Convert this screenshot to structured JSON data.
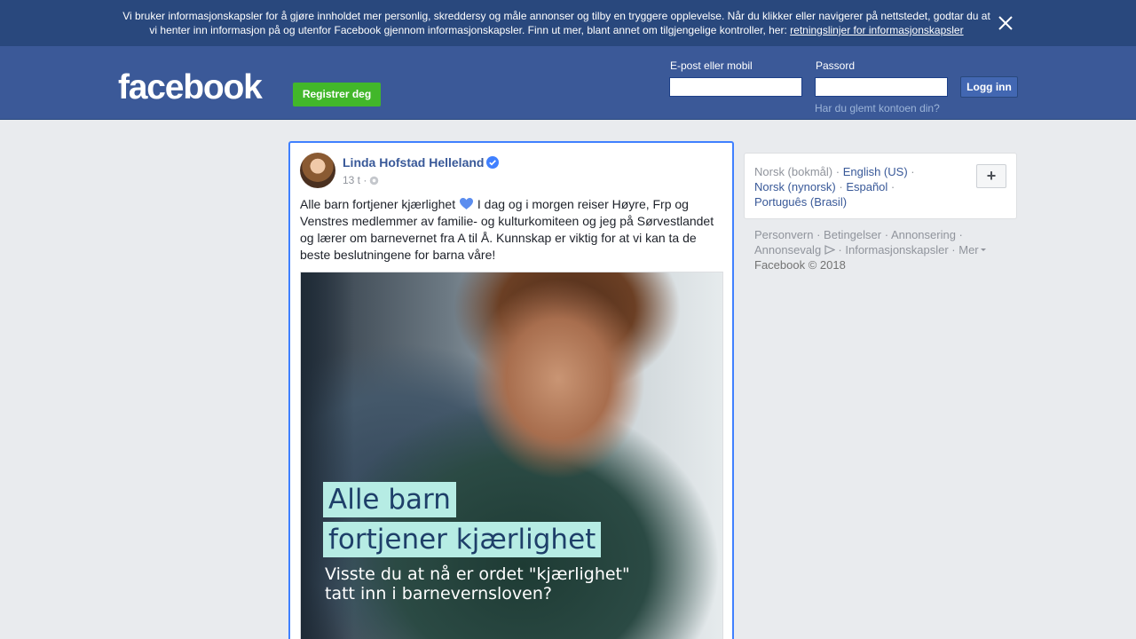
{
  "cookie_banner": {
    "text_line1": "Vi bruker informasjonskapsler for å gjøre innholdet mer personlig, skreddersy og måle annonser og tilby en tryggere opplevelse. Når du klikker eller navigerer på nettstedet, godtar du at",
    "text_line2": "vi henter inn informasjon på og utenfor Facebook gjennom informasjonskapsler. Finn ut mer, blant annet om tilgjengelige kontroller, her:",
    "link": "retningslinjer for informasjonskapsler",
    "close_icon": "close-icon"
  },
  "header": {
    "logo": "facebook",
    "register_label": "Registrer deg",
    "email_label": "E-post eller mobil",
    "email_value": "",
    "password_label": "Passord",
    "password_value": "",
    "login_label": "Logg inn",
    "forgot_label": "Har du glemt kontoen din?"
  },
  "post": {
    "author": "Linda Hofstad Helleland",
    "verified_icon": "verified-badge-icon",
    "time": "13 t ·",
    "privacy_icon": "globe-icon",
    "text_before_heart": "Alle barn fortjener kjærlighet",
    "text_after_heart": " I dag og i morgen reiser Høyre, Frp og Venstres medlemmer av familie- og kulturkomiteen og jeg på Sørvestlandet og lærer om barnevernet fra A til Å. Kunnskap er viktig for at vi kan ta de beste beslutningene for barna våre!",
    "heart_icon": "blue-heart-icon",
    "image": {
      "title_line1": "Alle barn",
      "title_line2": "fortjener kjærlighet",
      "subtitle_line1": "Visste du at nå er ordet \"kjærlighet\"",
      "subtitle_line2": "tatt inn i barnevernsloven?",
      "title_bg_color": "#b6ece4",
      "title_text_color": "#1e3f69"
    }
  },
  "sidebar": {
    "languages": {
      "current": "Norsk (bokmål)",
      "links": [
        "English (US)",
        "Norsk (nynorsk)",
        "Español",
        "Português (Brasil)"
      ],
      "add_button": "+"
    },
    "footer": {
      "links": [
        "Personvern",
        "Betingelser",
        "Annonsering",
        "Annonsevalg",
        "Informasjonskapsler",
        "Mer"
      ],
      "adchoices_icon": "adchoices-icon",
      "copyright": "Facebook © 2018"
    }
  },
  "colors": {
    "brand_blue": "#3b5998",
    "banner_blue": "#29487d",
    "green": "#42b72a",
    "link_blue": "#385898",
    "focus_border": "#4080ff",
    "page_bg": "#e9ebee"
  }
}
